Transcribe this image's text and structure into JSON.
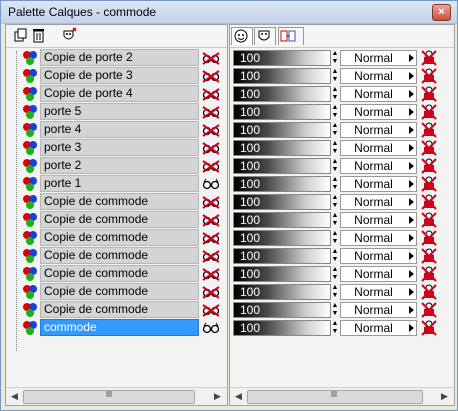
{
  "window": {
    "title": "Palette Calques - commode",
    "close_label": "×"
  },
  "toolbar": {
    "left_icons": [
      "new-layer-icon",
      "delete-layer-icon",
      "mask-icon"
    ],
    "tabs": [
      "tab-display",
      "tab-mask",
      "tab-links"
    ]
  },
  "layers": [
    {
      "name": "Copie de porte 2",
      "visible": false,
      "opacity": "100",
      "blend": "Normal"
    },
    {
      "name": "Copie de porte 3",
      "visible": false,
      "opacity": "100",
      "blend": "Normal"
    },
    {
      "name": "Copie de porte 4",
      "visible": false,
      "opacity": "100",
      "blend": "Normal"
    },
    {
      "name": "porte 5",
      "visible": false,
      "opacity": "100",
      "blend": "Normal"
    },
    {
      "name": "porte 4",
      "visible": false,
      "opacity": "100",
      "blend": "Normal"
    },
    {
      "name": "porte 3",
      "visible": false,
      "opacity": "100",
      "blend": "Normal"
    },
    {
      "name": "porte 2",
      "visible": false,
      "opacity": "100",
      "blend": "Normal"
    },
    {
      "name": "porte 1",
      "visible": true,
      "opacity": "100",
      "blend": "Normal"
    },
    {
      "name": "Copie de commode",
      "visible": false,
      "opacity": "100",
      "blend": "Normal"
    },
    {
      "name": "Copie de commode",
      "visible": false,
      "opacity": "100",
      "blend": "Normal"
    },
    {
      "name": "Copie de commode",
      "visible": false,
      "opacity": "100",
      "blend": "Normal"
    },
    {
      "name": "Copie de commode",
      "visible": false,
      "opacity": "100",
      "blend": "Normal"
    },
    {
      "name": "Copie de commode",
      "visible": false,
      "opacity": "100",
      "blend": "Normal"
    },
    {
      "name": "Copie de commode",
      "visible": false,
      "opacity": "100",
      "blend": "Normal"
    },
    {
      "name": "Copie de commode",
      "visible": false,
      "opacity": "100",
      "blend": "Normal"
    },
    {
      "name": "commode",
      "visible": true,
      "opacity": "100",
      "blend": "Normal",
      "selected": true
    }
  ],
  "colors": {
    "selected": "#3399ff",
    "hidden": "#d0021b"
  }
}
